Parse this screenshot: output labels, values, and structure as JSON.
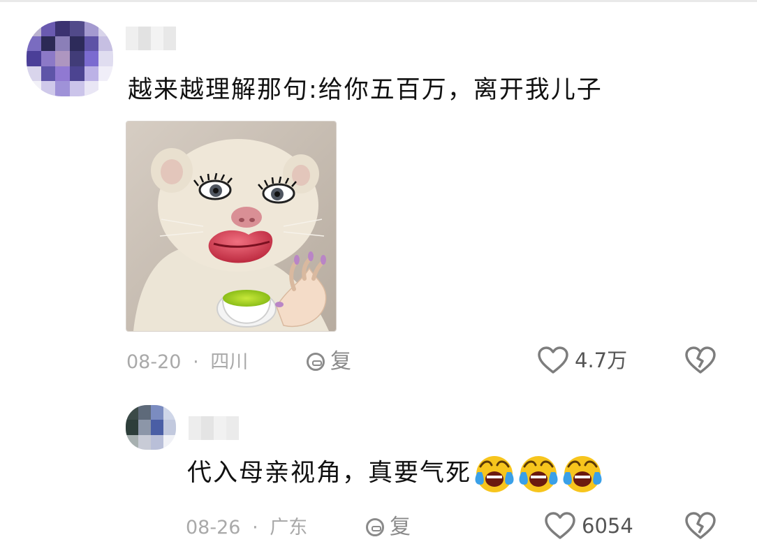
{
  "comments": [
    {
      "text": "越来越理解那句:给你五百万，离开我儿子",
      "date": "08-20",
      "separator": "·",
      "location": "四川",
      "reply_label": "复",
      "likes": "4.7万"
    },
    {
      "text": "代入母亲视角，真要气死",
      "date": "08-26",
      "separator": "·",
      "location": "广东",
      "reply_label": "复",
      "likes": "6054",
      "emoji": "laughing-crying-emoji"
    }
  ],
  "icons": {
    "like": "heart-outline-icon",
    "dislike": "broken-heart-icon",
    "reply": "reply-bubble-icon"
  },
  "colors": {
    "meta_text": "#a9a9a9",
    "icon_gray": "#8a8a8a",
    "emoji_yellow": "#f7c51d",
    "emoji_blue": "#3aa0e8"
  }
}
